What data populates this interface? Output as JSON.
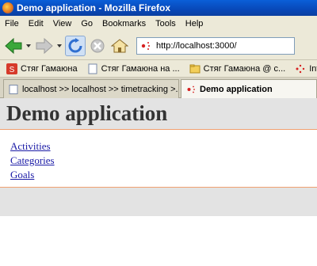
{
  "window": {
    "title": "Demo application - Mozilla Firefox"
  },
  "menu": [
    "File",
    "Edit",
    "View",
    "Go",
    "Bookmarks",
    "Tools",
    "Help"
  ],
  "address_bar": {
    "url": "http://localhost:3000/"
  },
  "bookmarks": [
    {
      "label": "Стяг Гамаюна",
      "icon": "s-icon"
    },
    {
      "label": "Стяг Гамаюна на ...",
      "icon": "page-icon"
    },
    {
      "label": "Стяг Гамаюна @ с...",
      "icon": "folder-icon"
    },
    {
      "label": "IntraNe",
      "icon": "dots-icon"
    }
  ],
  "tabs": [
    {
      "label": "localhost >> localhost >> timetracking >...",
      "active": false
    },
    {
      "label": "Demo application",
      "active": true
    }
  ],
  "page": {
    "title": "Demo application",
    "links": [
      "Activities",
      "Categories",
      "Goals"
    ]
  }
}
